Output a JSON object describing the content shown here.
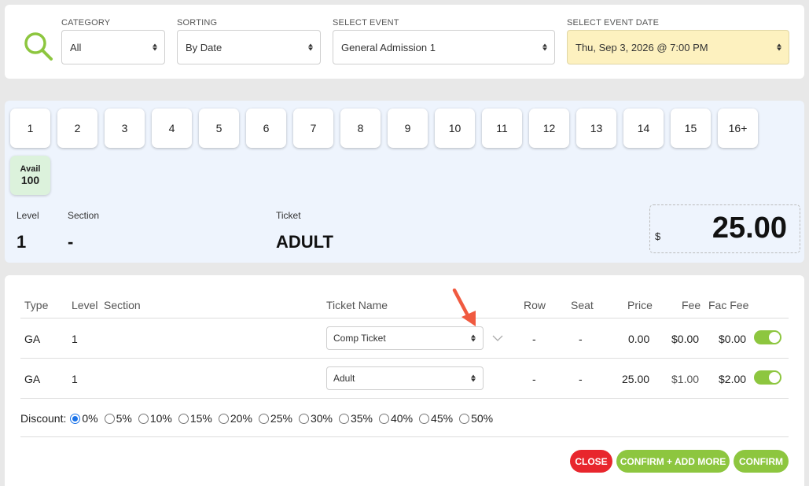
{
  "filters": {
    "category": {
      "label": "CATEGORY",
      "value": "All"
    },
    "sorting": {
      "label": "SORTING",
      "value": "By Date"
    },
    "event": {
      "label": "SELECT EVENT",
      "value": "General Admission 1"
    },
    "event_date": {
      "label": "SELECT EVENT DATE",
      "value": "Thu, Sep 3, 2026 @ 7:00 PM"
    }
  },
  "quantities": [
    "1",
    "2",
    "3",
    "4",
    "5",
    "6",
    "7",
    "8",
    "9",
    "10",
    "11",
    "12",
    "13",
    "14",
    "15",
    "16+"
  ],
  "avail": {
    "label": "Avail",
    "value": "100"
  },
  "summary": {
    "level_label": "Level",
    "level_value": "1",
    "section_label": "Section",
    "section_value": "-",
    "ticket_label": "Ticket",
    "ticket_value": "ADULT",
    "currency": "$",
    "price": "25.00"
  },
  "table": {
    "headers": {
      "type": "Type",
      "level": "Level",
      "section": "Section",
      "ticket_name": "Ticket Name",
      "row": "Row",
      "seat": "Seat",
      "price": "Price",
      "fee": "Fee",
      "fac_fee": "Fac Fee"
    },
    "rows": [
      {
        "type": "GA",
        "level": "1",
        "ticket_name": "Comp Ticket",
        "row": "-",
        "seat": "-",
        "price": "0.00",
        "fee": "$0.00",
        "fac_fee": "$0.00"
      },
      {
        "type": "GA",
        "level": "1",
        "ticket_name": "Adult",
        "row": "-",
        "seat": "-",
        "price": "25.00",
        "fee": "$1.00",
        "fac_fee": "$2.00"
      }
    ]
  },
  "discount": {
    "label": "Discount:",
    "options": [
      "0%",
      "5%",
      "10%",
      "15%",
      "20%",
      "25%",
      "30%",
      "35%",
      "40%",
      "45%",
      "50%"
    ],
    "selected": "0%"
  },
  "actions": {
    "close": "CLOSE",
    "confirm_add_more": "CONFIRM + ADD MORE",
    "confirm": "CONFIRM"
  },
  "colors": {
    "accent_green": "#8dc63f",
    "close_red": "#e8262d",
    "date_highlight": "#fdf1bf",
    "pointer": "#f05a40"
  },
  "icons": {
    "search": "search-icon",
    "pointer": "red-arrow-pointer-icon",
    "chevron": "chevron-down-icon"
  }
}
